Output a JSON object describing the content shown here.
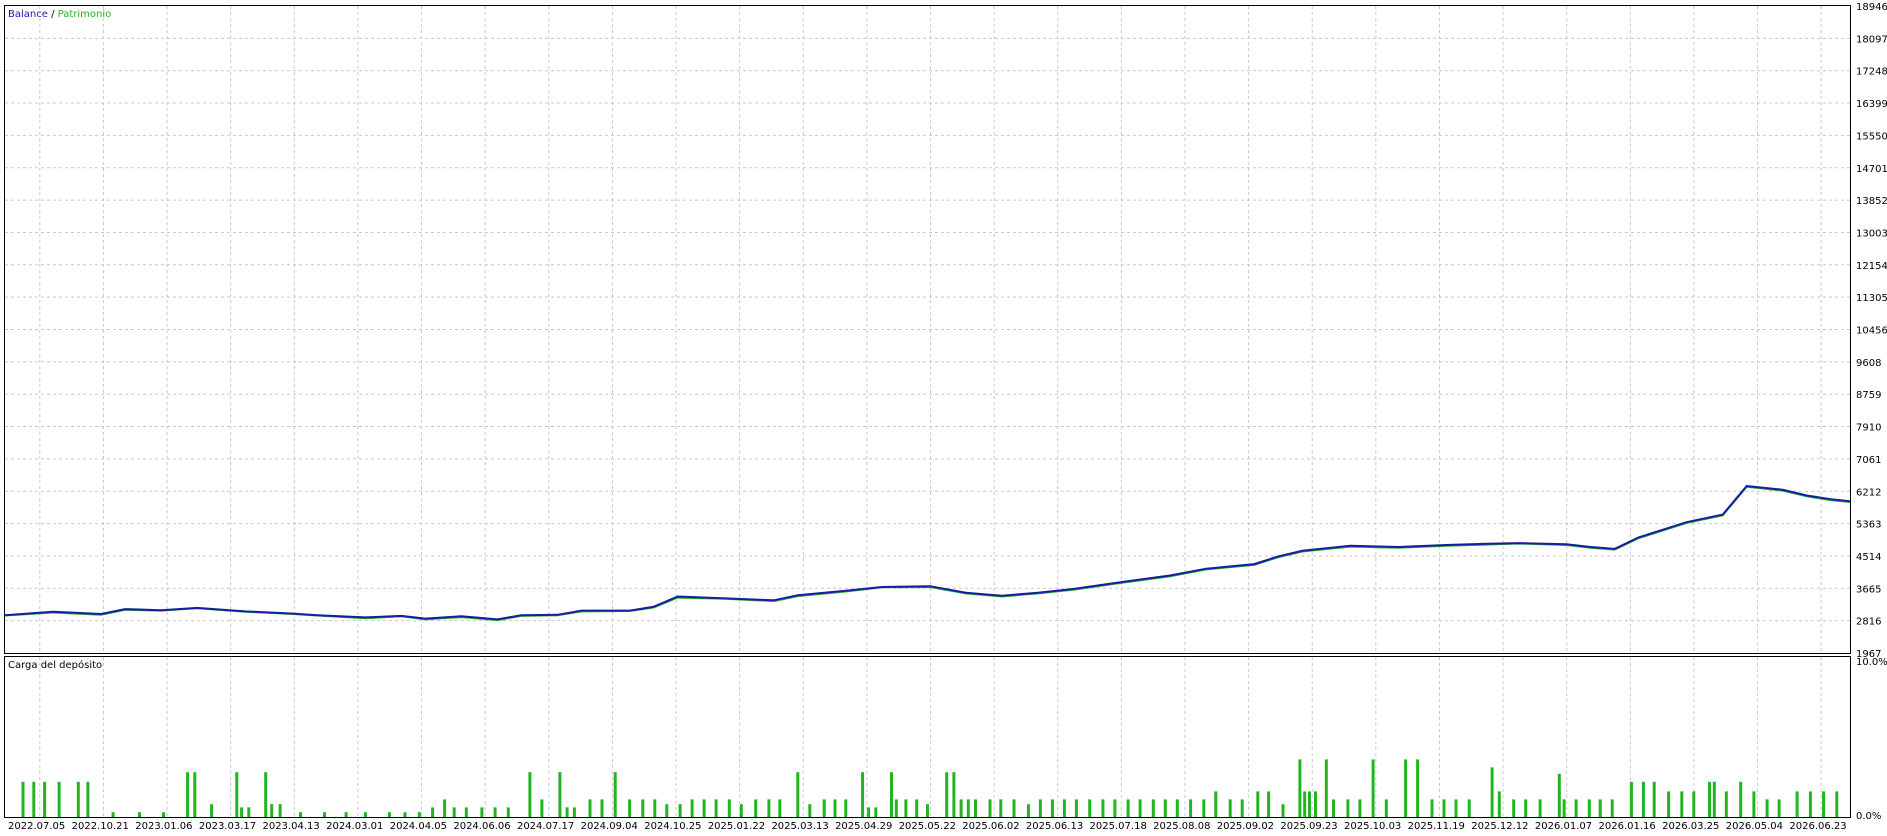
{
  "legend": {
    "balance_label": "Balance",
    "separator": " / ",
    "equity_label": "Patrimonio"
  },
  "colors": {
    "balance": "#1a1aa6",
    "equity": "#21b521",
    "deposit_bar": "#21b521",
    "grid": "#c8c8c8",
    "background": "#ffffff"
  },
  "deposit_panel": {
    "title": "Carga del depósito",
    "top_label": "10.0%",
    "bottom_label": "0.0%"
  },
  "chart_data": [
    {
      "type": "line",
      "title": "",
      "legend_placement": "top-left",
      "grid": true,
      "ylim": [
        1967,
        18946
      ],
      "y_ticks": [
        "18946",
        "18097",
        "17248",
        "16399",
        "15550",
        "14701",
        "13852",
        "13003",
        "12154",
        "11305",
        "10456",
        "9608",
        "8759",
        "7910",
        "7061",
        "6212",
        "5363",
        "4514",
        "3665",
        "2816",
        "1967"
      ],
      "x_ticks": [
        "2022.07.05",
        "2022.10.21",
        "2023.01.06",
        "2023.03.17",
        "2023.04.13",
        "2024.03.01",
        "2024.04.05",
        "2024.06.06",
        "2024.07.17",
        "2024.09.04",
        "2024.10.25",
        "2025.01.22",
        "2025.03.13",
        "2025.04.29",
        "2025.05.22",
        "2025.06.02",
        "2025.06.13",
        "2025.07.18",
        "2025.08.08",
        "2025.09.02",
        "2025.09.23",
        "2025.10.03",
        "2025.11.19",
        "2025.12.12",
        "2026.01.07",
        "2026.01.16",
        "2026.03.25",
        "2026.05.04",
        "2026.06.23"
      ],
      "x_range": [
        0,
        1536
      ],
      "series": [
        {
          "name": "Balance",
          "points": [
            [
              0,
              2960
            ],
            [
              40,
              3050
            ],
            [
              80,
              2990
            ],
            [
              100,
              3120
            ],
            [
              130,
              3090
            ],
            [
              160,
              3150
            ],
            [
              200,
              3060
            ],
            [
              240,
              3000
            ],
            [
              260,
              2960
            ],
            [
              300,
              2900
            ],
            [
              330,
              2940
            ],
            [
              350,
              2870
            ],
            [
              380,
              2930
            ],
            [
              410,
              2850
            ],
            [
              430,
              2960
            ],
            [
              460,
              2970
            ],
            [
              480,
              3080
            ],
            [
              520,
              3080
            ],
            [
              540,
              3180
            ],
            [
              560,
              3450
            ],
            [
              600,
              3400
            ],
            [
              640,
              3350
            ],
            [
              660,
              3480
            ],
            [
              700,
              3600
            ],
            [
              730,
              3700
            ],
            [
              770,
              3720
            ],
            [
              800,
              3550
            ],
            [
              830,
              3470
            ],
            [
              860,
              3550
            ],
            [
              890,
              3650
            ],
            [
              930,
              3830
            ],
            [
              970,
              4000
            ],
            [
              1000,
              4180
            ],
            [
              1040,
              4300
            ],
            [
              1060,
              4500
            ],
            [
              1080,
              4650
            ],
            [
              1120,
              4780
            ],
            [
              1160,
              4750
            ],
            [
              1200,
              4800
            ],
            [
              1230,
              4830
            ],
            [
              1260,
              4850
            ],
            [
              1300,
              4820
            ],
            [
              1320,
              4750
            ],
            [
              1340,
              4700
            ],
            [
              1360,
              5000
            ],
            [
              1380,
              5200
            ],
            [
              1400,
              5400
            ],
            [
              1430,
              5600
            ],
            [
              1450,
              6350
            ],
            [
              1480,
              6250
            ],
            [
              1500,
              6100
            ],
            [
              1520,
              6000
            ],
            [
              1536,
              5950
            ]
          ]
        },
        {
          "name": "Patrimonio",
          "points": [
            [
              0,
              2950
            ],
            [
              40,
              3030
            ],
            [
              80,
              2970
            ],
            [
              100,
              3100
            ],
            [
              130,
              3080
            ],
            [
              160,
              3140
            ],
            [
              200,
              3050
            ],
            [
              240,
              2990
            ],
            [
              260,
              2950
            ],
            [
              300,
              2880
            ],
            [
              330,
              2930
            ],
            [
              350,
              2850
            ],
            [
              380,
              2910
            ],
            [
              410,
              2830
            ],
            [
              430,
              2940
            ],
            [
              460,
              2960
            ],
            [
              480,
              3060
            ],
            [
              520,
              3070
            ],
            [
              540,
              3160
            ],
            [
              560,
              3420
            ],
            [
              600,
              3390
            ],
            [
              640,
              3330
            ],
            [
              660,
              3460
            ],
            [
              700,
              3580
            ],
            [
              730,
              3690
            ],
            [
              770,
              3700
            ],
            [
              800,
              3530
            ],
            [
              830,
              3450
            ],
            [
              860,
              3530
            ],
            [
              890,
              3630
            ],
            [
              930,
              3810
            ],
            [
              970,
              3980
            ],
            [
              1000,
              4160
            ],
            [
              1040,
              4280
            ],
            [
              1060,
              4480
            ],
            [
              1080,
              4630
            ],
            [
              1120,
              4760
            ],
            [
              1160,
              4730
            ],
            [
              1200,
              4780
            ],
            [
              1230,
              4810
            ],
            [
              1260,
              4840
            ],
            [
              1300,
              4800
            ],
            [
              1320,
              4730
            ],
            [
              1340,
              4680
            ],
            [
              1360,
              4980
            ],
            [
              1380,
              5180
            ],
            [
              1400,
              5380
            ],
            [
              1430,
              5580
            ],
            [
              1450,
              6330
            ],
            [
              1480,
              6230
            ],
            [
              1500,
              6080
            ],
            [
              1520,
              5980
            ],
            [
              1536,
              5930
            ]
          ]
        }
      ]
    },
    {
      "type": "bar",
      "title": "Carga del depósito",
      "ylim": [
        0,
        10
      ],
      "x_range": [
        0,
        1536
      ],
      "series": [
        {
          "name": "Carga del depósito",
          "points": [
            [
              15,
              2.2
            ],
            [
              24,
              2.2
            ],
            [
              33,
              2.2
            ],
            [
              45,
              2.2
            ],
            [
              61,
              2.2
            ],
            [
              69,
              2.2
            ],
            [
              90,
              0.3
            ],
            [
              112,
              0.3
            ],
            [
              132,
              0.3
            ],
            [
              152,
              2.8
            ],
            [
              158,
              2.8
            ],
            [
              172,
              0.8
            ],
            [
              193,
              2.8
            ],
            [
              197,
              0.6
            ],
            [
              203,
              0.6
            ],
            [
              217,
              2.8
            ],
            [
              222,
              0.8
            ],
            [
              229,
              0.8
            ],
            [
              246,
              0.3
            ],
            [
              266,
              0.3
            ],
            [
              284,
              0.3
            ],
            [
              300,
              0.3
            ],
            [
              320,
              0.3
            ],
            [
              333,
              0.3
            ],
            [
              345,
              0.3
            ],
            [
              356,
              0.6
            ],
            [
              366,
              1.1
            ],
            [
              374,
              0.6
            ],
            [
              384,
              0.6
            ],
            [
              397,
              0.6
            ],
            [
              408,
              0.6
            ],
            [
              419,
              0.6
            ],
            [
              437,
              2.8
            ],
            [
              447,
              1.1
            ],
            [
              462,
              2.8
            ],
            [
              468,
              0.6
            ],
            [
              474,
              0.6
            ],
            [
              487,
              1.1
            ],
            [
              497,
              1.1
            ],
            [
              508,
              2.8
            ],
            [
              520,
              1.1
            ],
            [
              531,
              1.1
            ],
            [
              541,
              1.1
            ],
            [
              551,
              0.8
            ],
            [
              562,
              0.8
            ],
            [
              572,
              1.1
            ],
            [
              582,
              1.1
            ],
            [
              592,
              1.1
            ],
            [
              603,
              1.1
            ],
            [
              613,
              0.8
            ],
            [
              625,
              1.1
            ],
            [
              636,
              1.1
            ],
            [
              645,
              1.1
            ],
            [
              660,
              2.8
            ],
            [
              670,
              0.8
            ],
            [
              682,
              1.1
            ],
            [
              691,
              1.1
            ],
            [
              700,
              1.1
            ],
            [
              714,
              2.8
            ],
            [
              719,
              0.6
            ],
            [
              725,
              0.6
            ],
            [
              738,
              2.8
            ],
            [
              742,
              1.1
            ],
            [
              750,
              1.1
            ],
            [
              759,
              1.1
            ],
            [
              768,
              0.8
            ],
            [
              784,
              2.8
            ],
            [
              790,
              2.8
            ],
            [
              796,
              1.1
            ],
            [
              802,
              1.1
            ],
            [
              808,
              1.1
            ],
            [
              820,
              1.1
            ],
            [
              829,
              1.1
            ],
            [
              840,
              1.1
            ],
            [
              852,
              0.8
            ],
            [
              862,
              1.1
            ],
            [
              872,
              1.1
            ],
            [
              882,
              1.1
            ],
            [
              892,
              1.1
            ],
            [
              903,
              1.1
            ],
            [
              914,
              1.1
            ],
            [
              924,
              1.1
            ],
            [
              935,
              1.1
            ],
            [
              945,
              1.1
            ],
            [
              956,
              1.1
            ],
            [
              966,
              1.1
            ],
            [
              976,
              1.1
            ],
            [
              987,
              1.1
            ],
            [
              998,
              1.1
            ],
            [
              1008,
              1.6
            ],
            [
              1020,
              1.1
            ],
            [
              1030,
              1.1
            ],
            [
              1043,
              1.6
            ],
            [
              1052,
              1.6
            ],
            [
              1064,
              0.8
            ],
            [
              1078,
              3.6
            ],
            [
              1082,
              1.6
            ],
            [
              1086,
              1.6
            ],
            [
              1091,
              1.6
            ],
            [
              1100,
              3.6
            ],
            [
              1106,
              1.1
            ],
            [
              1118,
              1.1
            ],
            [
              1128,
              1.1
            ],
            [
              1139,
              3.6
            ],
            [
              1150,
              1.1
            ],
            [
              1166,
              3.6
            ],
            [
              1176,
              3.6
            ],
            [
              1188,
              1.1
            ],
            [
              1198,
              1.1
            ],
            [
              1208,
              1.1
            ],
            [
              1219,
              1.1
            ],
            [
              1238,
              3.1
            ],
            [
              1244,
              1.6
            ],
            [
              1256,
              1.1
            ],
            [
              1266,
              1.1
            ],
            [
              1278,
              1.1
            ],
            [
              1294,
              2.7
            ],
            [
              1298,
              1.1
            ],
            [
              1308,
              1.1
            ],
            [
              1319,
              1.1
            ],
            [
              1328,
              1.1
            ],
            [
              1338,
              1.1
            ],
            [
              1354,
              2.2
            ],
            [
              1364,
              2.2
            ],
            [
              1373,
              2.2
            ],
            [
              1385,
              1.6
            ],
            [
              1396,
              1.6
            ],
            [
              1406,
              1.6
            ],
            [
              1419,
              2.2
            ],
            [
              1423,
              2.2
            ],
            [
              1433,
              1.6
            ],
            [
              1445,
              2.2
            ],
            [
              1456,
              1.6
            ],
            [
              1467,
              1.1
            ],
            [
              1477,
              1.1
            ],
            [
              1492,
              1.6
            ],
            [
              1503,
              1.6
            ],
            [
              1514,
              1.6
            ],
            [
              1525,
              1.6
            ]
          ]
        }
      ]
    }
  ]
}
